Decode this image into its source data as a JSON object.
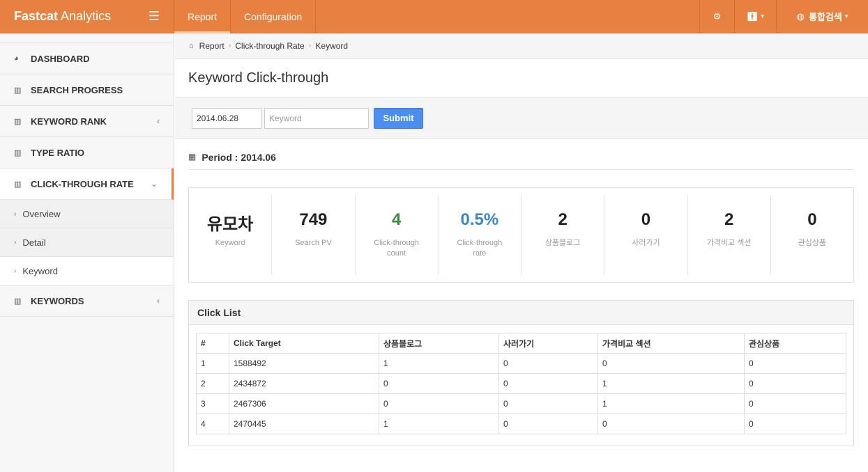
{
  "brand": {
    "bold": "Fastcat",
    "rest": " Analytics"
  },
  "topnav": {
    "tabs": [
      {
        "label": "Report",
        "active": true
      },
      {
        "label": "Configuration",
        "active": false
      }
    ],
    "search_label": "통합검색"
  },
  "sidebar": {
    "items": [
      {
        "label": "DASHBOARD",
        "icon": "dashboard-icon"
      },
      {
        "label": "SEARCH PROGRESS",
        "icon": "bar-chart-icon"
      },
      {
        "label": "KEYWORD RANK",
        "icon": "bar-chart-icon"
      },
      {
        "label": "TYPE RATIO",
        "icon": "bar-chart-icon"
      },
      {
        "label": "CLICK-THROUGH RATE",
        "icon": "bar-chart-icon"
      },
      {
        "label": "KEYWORDS",
        "icon": "bar-chart-icon"
      }
    ],
    "subitems": [
      "Overview",
      "Detail",
      "Keyword"
    ]
  },
  "breadcrumb": [
    "Report",
    "Click-through Rate",
    "Keyword"
  ],
  "page_title": "Keyword Click-through",
  "form": {
    "date_value": "2014.06.28",
    "keyword_placeholder": "Keyword",
    "submit_label": "Submit"
  },
  "period": "Period : 2014.06",
  "stats": [
    {
      "value": "유모차",
      "label": "Keyword"
    },
    {
      "value": "749",
      "label": "Search PV"
    },
    {
      "value": "4",
      "label": "Click-through count"
    },
    {
      "value": "0.5%",
      "label": "Click-through rate"
    },
    {
      "value": "2",
      "label": "상품블로그"
    },
    {
      "value": "0",
      "label": "사러가기"
    },
    {
      "value": "2",
      "label": "가격비교 섹션"
    },
    {
      "value": "0",
      "label": "관심상품"
    }
  ],
  "colors": {
    "brand": "#e8813f",
    "green": "#3c8a3c",
    "blue": "#3a87c9",
    "button": "#4a8ff0"
  },
  "click_list": {
    "title": "Click List",
    "headers": [
      "#",
      "Click Target",
      "상품블로그",
      "사러가기",
      "가격비교 섹션",
      "관심상품"
    ],
    "rows": [
      [
        "1",
        "1588492",
        "1",
        "0",
        "0",
        "0"
      ],
      [
        "2",
        "2434872",
        "0",
        "0",
        "1",
        "0"
      ],
      [
        "3",
        "2467306",
        "0",
        "0",
        "1",
        "0"
      ],
      [
        "4",
        "2470445",
        "1",
        "0",
        "0",
        "0"
      ]
    ]
  }
}
